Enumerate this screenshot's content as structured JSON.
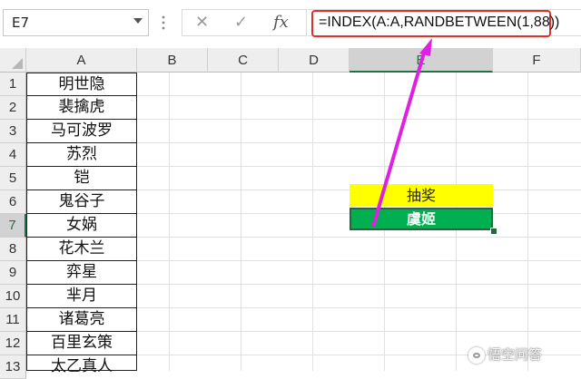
{
  "formula_bar": {
    "name_box": "E7",
    "cancel_icon": "✕",
    "enter_icon": "✓",
    "fx_label": "fx",
    "formula": "=INDEX(A:A,RANDBETWEEN(1,88))"
  },
  "columns": [
    "A",
    "B",
    "C",
    "D",
    "E",
    "F"
  ],
  "selected_column": "E",
  "rows": [
    "1",
    "2",
    "3",
    "4",
    "5",
    "6",
    "7",
    "8",
    "9",
    "10",
    "11",
    "12",
    "13"
  ],
  "selected_row": "7",
  "column_a": [
    "明世隐",
    "裴擒虎",
    "马可波罗",
    "苏烈",
    "铠",
    "鬼谷子",
    "女娲",
    "花木兰",
    "弈星",
    "芈月",
    "诸葛亮",
    "百里玄策",
    "太乙真人"
  ],
  "cells": {
    "E6": "抽奖",
    "E7": "虞姬"
  },
  "colors": {
    "lottery_fill": "#ffff00",
    "result_fill": "#00b050",
    "formula_highlight": "#e0302b",
    "annotation_arrow": "#e020e0"
  },
  "watermark": "悟空问答"
}
